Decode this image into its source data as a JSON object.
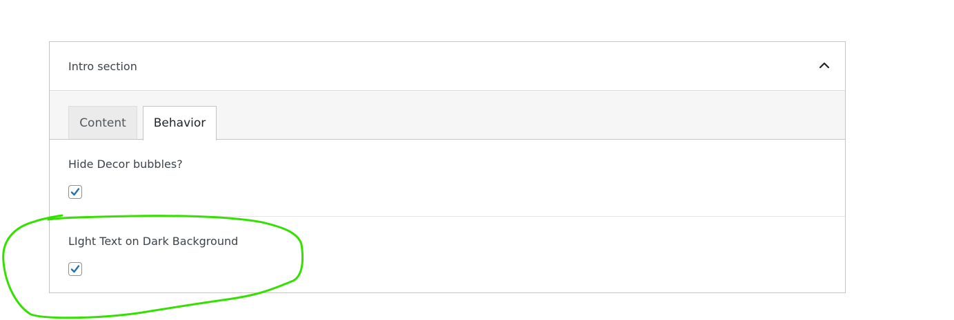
{
  "panel": {
    "title": "Intro section",
    "toggle_icon": "chevron-up-icon"
  },
  "tabs": [
    {
      "label": "Content",
      "active": false
    },
    {
      "label": "Behavior",
      "active": true
    }
  ],
  "fields": [
    {
      "label": "Hide Decor bubbles?",
      "checked": true
    },
    {
      "label": "LIght Text on Dark Background",
      "checked": true
    }
  ],
  "colors": {
    "check": "#2271b1",
    "annotation": "#33e000"
  }
}
